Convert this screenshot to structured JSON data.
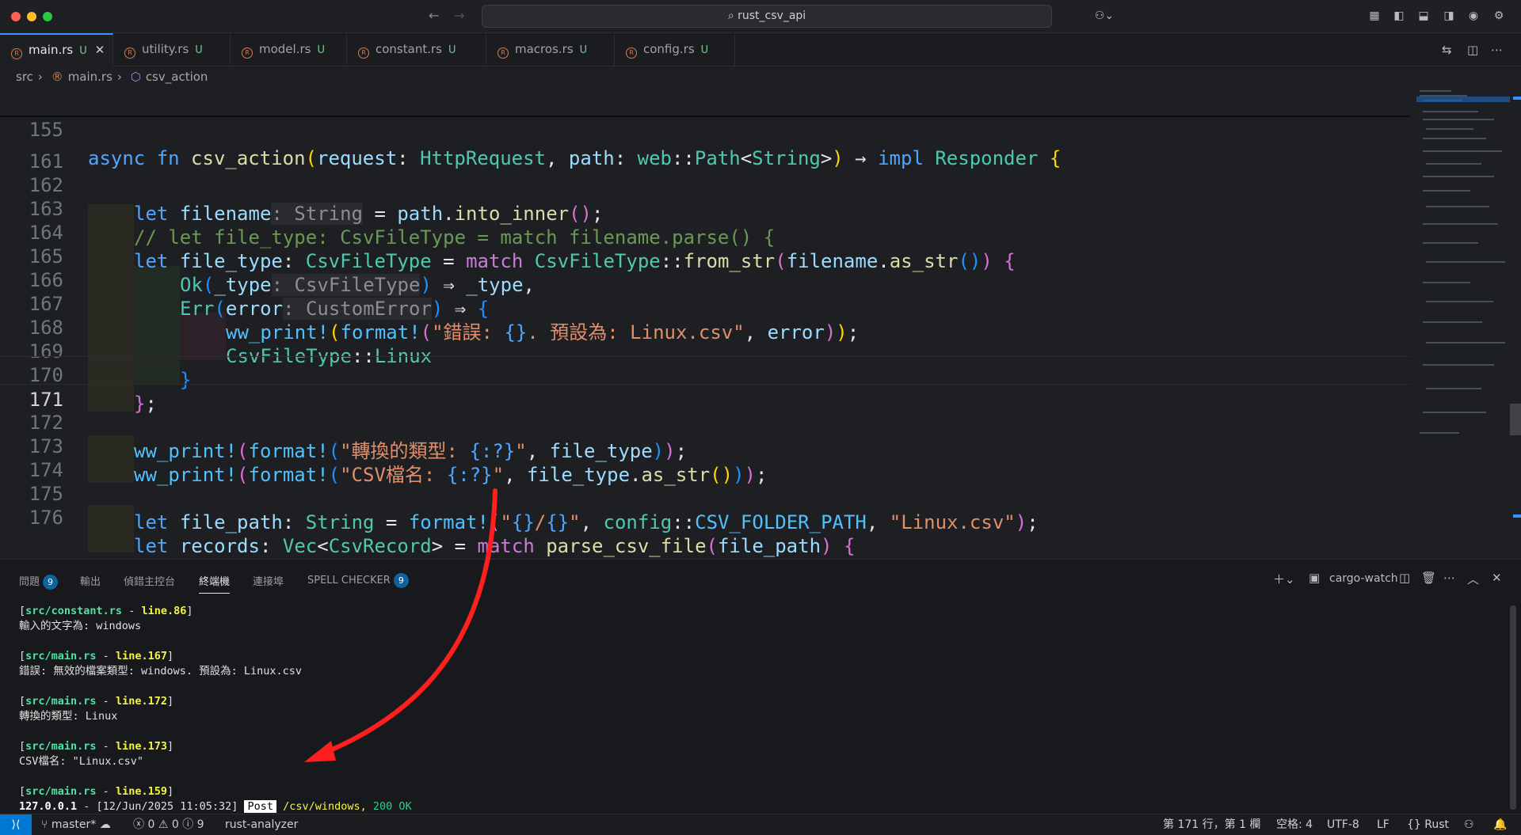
{
  "window": {
    "title": "rust_csv_api"
  },
  "tabs": [
    {
      "label": "main.rs",
      "status": "U",
      "active": true
    },
    {
      "label": "utility.rs",
      "status": "U",
      "active": false
    },
    {
      "label": "model.rs",
      "status": "U",
      "active": false
    },
    {
      "label": "constant.rs",
      "status": "U",
      "active": false
    },
    {
      "label": "macros.rs",
      "status": "U",
      "active": false
    },
    {
      "label": "config.rs",
      "status": "U",
      "active": false
    }
  ],
  "breadcrumb": [
    "src",
    "main.rs",
    "csv_action"
  ],
  "editor": {
    "current_line": "171",
    "line_numbers": [
      "155",
      "161",
      "162",
      "163",
      "164",
      "165",
      "166",
      "167",
      "168",
      "169",
      "170",
      "171",
      "172",
      "173",
      "174",
      "175",
      "176"
    ]
  },
  "panel": {
    "tabs": [
      {
        "label": "問題",
        "badge": "9"
      },
      {
        "label": "輸出"
      },
      {
        "label": "偵錯主控台"
      },
      {
        "label": "終端機",
        "active": true
      },
      {
        "label": "連接埠"
      },
      {
        "label": "SPELL CHECKER",
        "badge": "9"
      }
    ],
    "terminal_name": "cargo-watch",
    "terminal": {
      "b1_file": "src/constant.rs",
      "b1_line": "line.86",
      "b1_text": "輸入的文字為: windows",
      "b2_file": "src/main.rs",
      "b2_line": "line.167",
      "b2_text": "錯誤: 無效的檔案類型: windows. 預設為: Linux.csv",
      "b3_file": "src/main.rs",
      "b3_line": "line.172",
      "b3_text": "轉換的類型: Linux",
      "b4_file": "src/main.rs",
      "b4_line": "line.173",
      "b4_text": "CSV檔名: \"Linux.csv\"",
      "b5_file": "src/main.rs",
      "b5_line": "line.159",
      "log_ip": "127.0.0.1",
      "log_date": " - [12/Jun/2025 11:05:32] ",
      "log_method": "Post",
      "log_path": " /csv/windows,",
      "log_status": " 200 OK"
    }
  },
  "statusbar": {
    "branch": "master*",
    "errors": "0",
    "warnings": "0",
    "infos": "9",
    "analyzer": "rust-analyzer",
    "position": "第 171 行，第 1 欄",
    "spaces": "空格: 4",
    "encoding": "UTF-8",
    "eol": "LF",
    "language": "Rust"
  },
  "icons": {
    "accent": "#0078d4",
    "annotation_arrow": "#ff1f1f"
  }
}
